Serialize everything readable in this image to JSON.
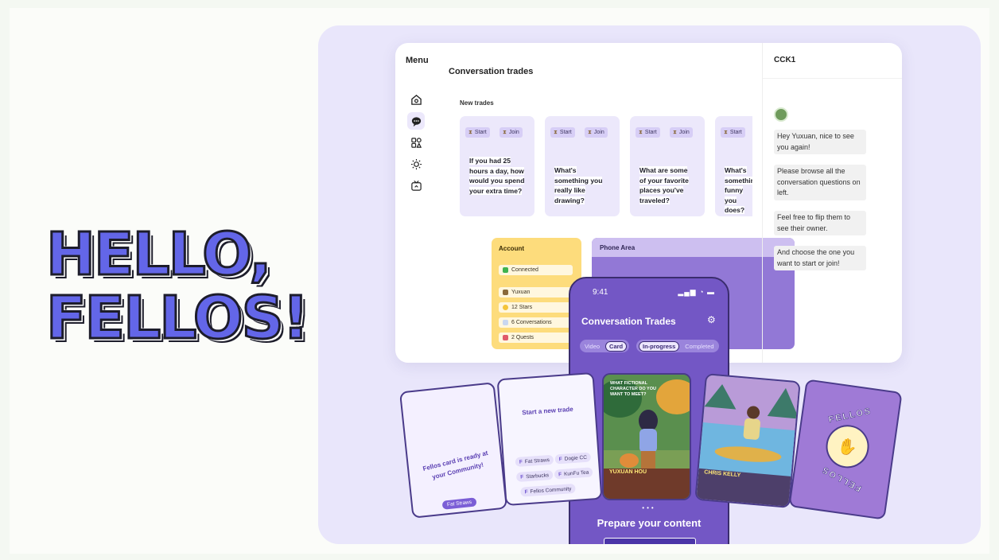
{
  "hero": {
    "line1": "HELLO,",
    "line2": "FELLOS!"
  },
  "sidebar": {
    "title": "Menu",
    "items": [
      {
        "icon": "home-icon"
      },
      {
        "icon": "chat-icon",
        "active": true
      },
      {
        "icon": "shapes-icon"
      },
      {
        "icon": "sun-icon"
      },
      {
        "icon": "tv-icon"
      }
    ]
  },
  "main": {
    "title": "Conversation trades",
    "new_trades_label": "New trades",
    "trades": [
      {
        "start": "Start",
        "join": "Join",
        "question": "If you had 25 hours a day, how would you spend your extra time?"
      },
      {
        "start": "Start",
        "join": "Join",
        "question": "What's something you really like drawing?"
      },
      {
        "start": "Start",
        "join": "Join",
        "question": "What are some of your favorite places you've traveled?"
      },
      {
        "start": "Start",
        "join": "Join",
        "question": "What's something funny you does?"
      }
    ],
    "account": {
      "title": "Account",
      "connected": "Connected",
      "name": "Yuxuan",
      "stars": "12 Stars",
      "conversations": "6 Conversations",
      "quests": "2 Quests"
    },
    "phone_area_title": "Phone Area"
  },
  "chat": {
    "title": "CCK1",
    "messages": [
      "Hey Yuxuan, nice to see you again!",
      "Please browse all the conversation questions on left.",
      "Feel free to flip them to see their owner.",
      "And choose the one you want to start or join!"
    ]
  },
  "phone": {
    "time": "9:41",
    "status_icons": "▂▄▆ ◔ ▬",
    "title": "Conversation Trades",
    "seg1": {
      "a": "Video",
      "b": "Card"
    },
    "seg2": {
      "a": "In-progress",
      "b": "Completed"
    },
    "dots": "•••",
    "cta": "Prepare your content"
  },
  "cards": {
    "ready": {
      "text": "Fellos card is ready at your Community!",
      "badge": "Fat Straws"
    },
    "new_trade": {
      "title": "Start a new trade",
      "communities": [
        "Fat Straws",
        "Dogie CC",
        "Starbucks",
        "KunFu Tea",
        "Fellos Community"
      ]
    },
    "art1": {
      "question": "WHAT FICTIONAL CHARACTER DO YOU WANT TO MEET?",
      "name": "YUXUAN HOU"
    },
    "art2": {
      "name": "CHRIS KELLY"
    },
    "back": {
      "brand": "FELLOS"
    }
  },
  "colors": {
    "accent": "#6366e8",
    "purple": "#7357c5",
    "yellow": "#fddc7c",
    "lavender": "#e9e6fb"
  }
}
